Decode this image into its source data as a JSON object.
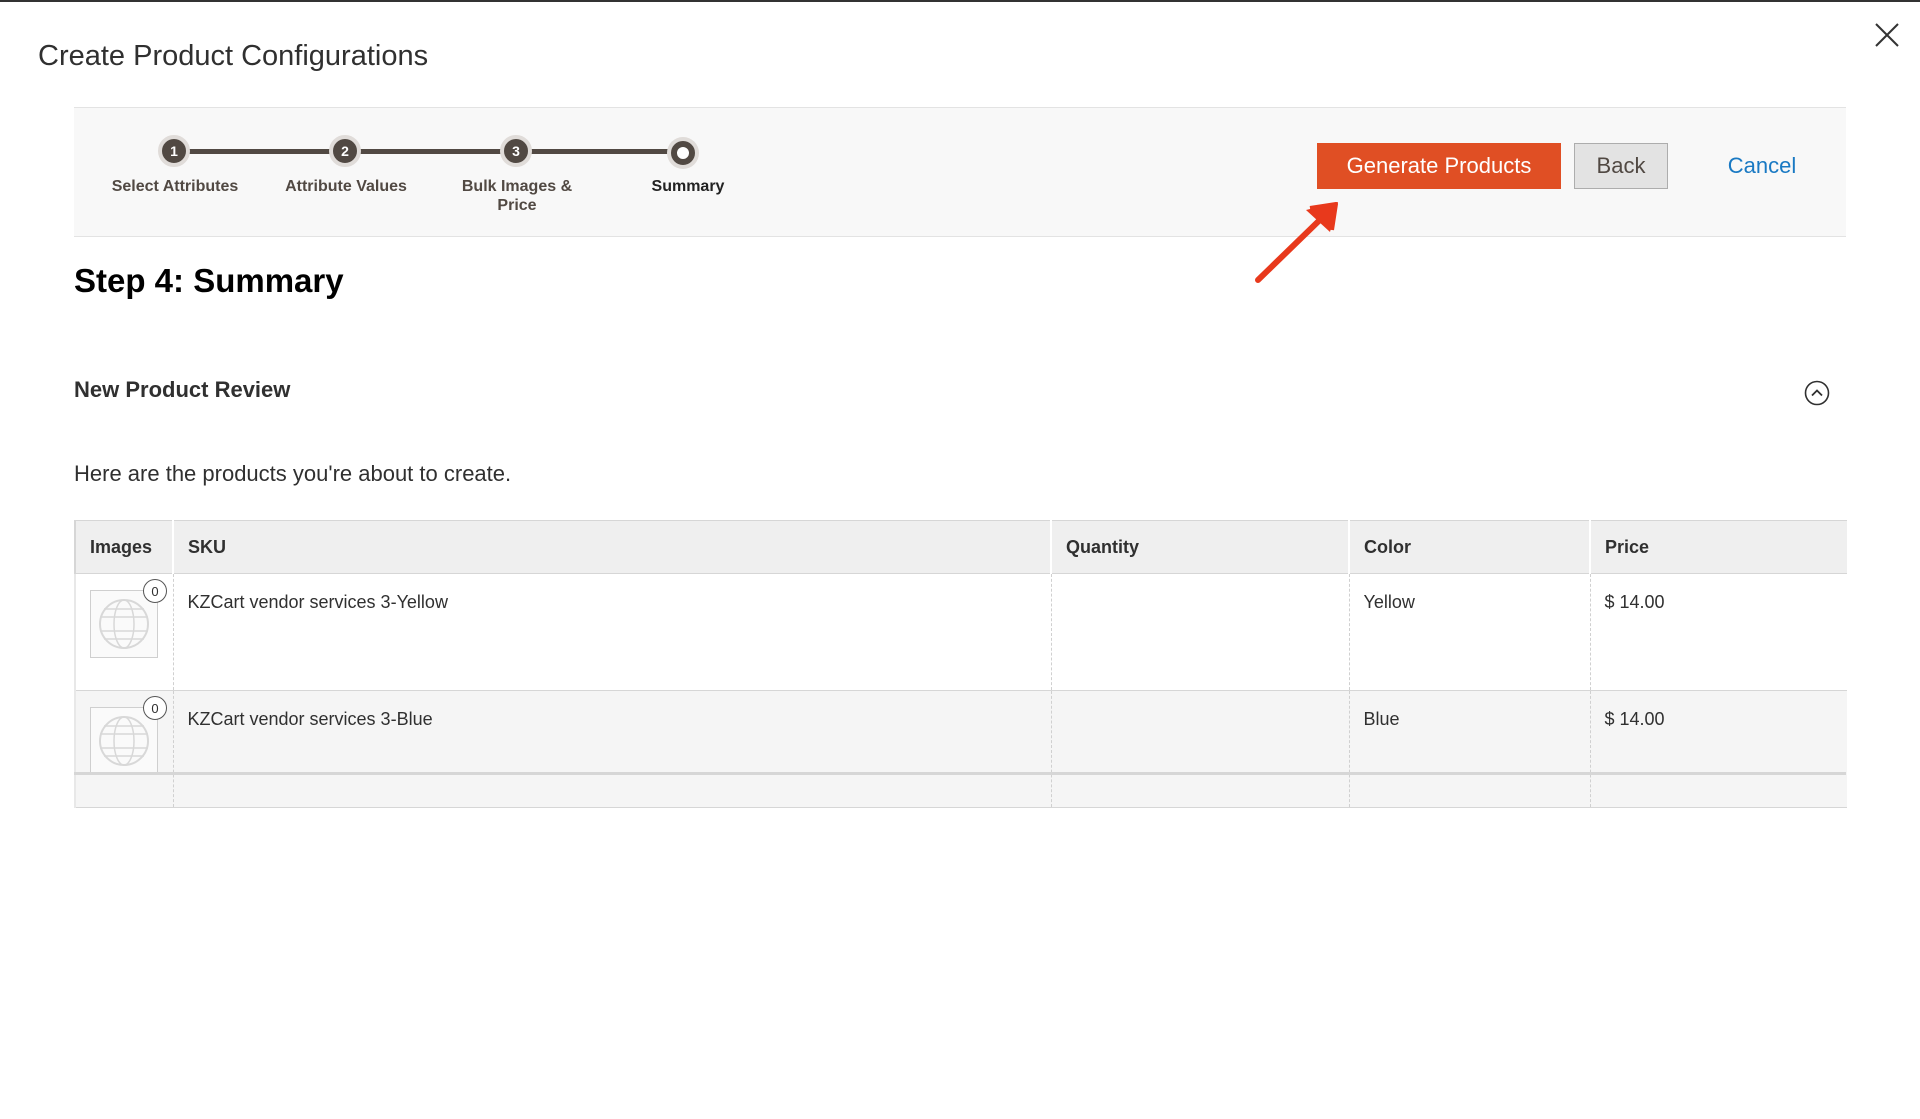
{
  "modal": {
    "title": "Create Product Configurations"
  },
  "wizard": {
    "steps": [
      {
        "number": "1",
        "label": "Select Attributes"
      },
      {
        "number": "2",
        "label": "Attribute Values"
      },
      {
        "number": "3",
        "label": "Bulk Images & Price"
      },
      {
        "number": "",
        "label": "Summary"
      }
    ],
    "current_step": 4
  },
  "actions": {
    "generate_label": "Generate Products",
    "back_label": "Back",
    "cancel_label": "Cancel"
  },
  "colors": {
    "primary_button": "#e04f24",
    "link": "#1979c3",
    "step_dark": "#514943",
    "annotation_arrow": "#e8391c"
  },
  "content": {
    "step_heading": "Step 4: Summary",
    "section_title": "New Product Review",
    "intro": "Here are the products you're about to create."
  },
  "table": {
    "columns": [
      "Images",
      "SKU",
      "Quantity",
      "Color",
      "Price"
    ],
    "rows": [
      {
        "image_count": "0",
        "sku": "KZCart vendor services 3-Yellow",
        "quantity": "",
        "color": "Yellow",
        "price": "$ 14.00"
      },
      {
        "image_count": "0",
        "sku": "KZCart vendor services 3-Blue",
        "quantity": "",
        "color": "Blue",
        "price": "$ 14.00"
      }
    ]
  },
  "icons": {
    "close": "close-icon",
    "collapse": "chevron-up-circle-icon",
    "placeholder": "image-placeholder-icon",
    "annotation": "arrow-icon"
  }
}
